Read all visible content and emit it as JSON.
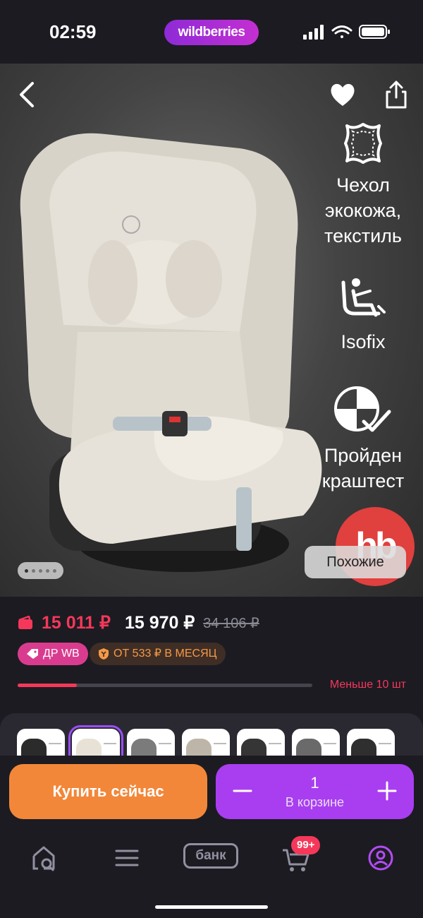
{
  "status_bar": {
    "time": "02:59",
    "brand": "wildberries"
  },
  "product": {
    "features": [
      {
        "icon": "leather-icon",
        "label_lines": [
          "Чехол",
          "экокожа,",
          "текстиль"
        ]
      },
      {
        "icon": "isofix-seat-icon",
        "label_lines": [
          "Isofix"
        ]
      },
      {
        "icon": "crash-test-icon",
        "label_lines": [
          "Пройден",
          "краштест"
        ]
      }
    ],
    "badge_logo_text": "hb",
    "similar_label": "Похожие",
    "gallery": {
      "count": 5,
      "active_index": 0
    }
  },
  "pricing": {
    "wallet_price": "15 011 ₽",
    "price": "15 970 ₽",
    "old_price": "34 106 ₽",
    "promo_tag": "ДР WB",
    "installment_tag": "ОТ 533 ₽ В МЕСЯЦ",
    "stock_label": "Меньше 10 шт",
    "stock_fraction": 0.2
  },
  "variants": {
    "thumbs": [
      {
        "color": "#2b2b2b"
      },
      {
        "color": "#e8e2d6",
        "selected": true
      },
      {
        "color": "#7b7b7b"
      },
      {
        "color": "#bdb6a8"
      },
      {
        "color": "#353535"
      },
      {
        "color": "#6a6a6a"
      },
      {
        "color": "#2f2f2f"
      }
    ]
  },
  "actions": {
    "buy_now": "Купить сейчас",
    "cart_qty": "1",
    "cart_label": "В корзине"
  },
  "tabbar": {
    "bank_label": "банк",
    "cart_badge": "99+"
  },
  "colors": {
    "background": "#1c1b22",
    "wallet_price": "#f5385a",
    "buy": "#f2873a",
    "cart": "#a93ef0",
    "brand": "#b02ed4"
  }
}
